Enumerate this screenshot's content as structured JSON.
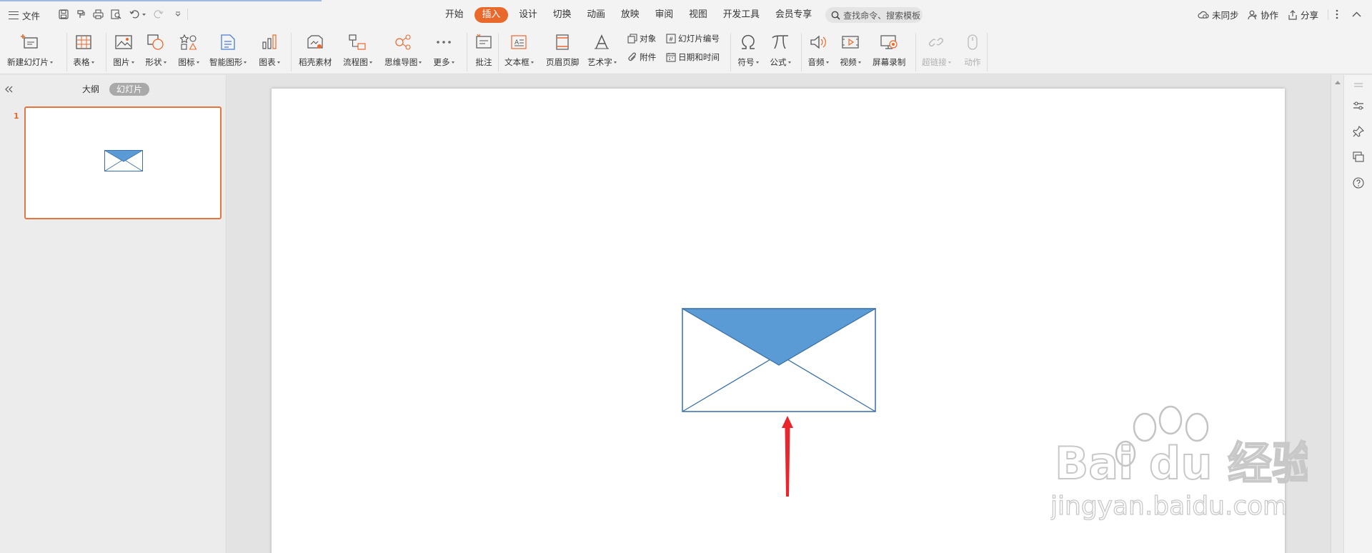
{
  "menubar": {
    "file_label": "文件",
    "tabs": [
      "开始",
      "插入",
      "设计",
      "切换",
      "动画",
      "放映",
      "审阅",
      "视图",
      "开发工具",
      "会员专享"
    ],
    "active_tab": "插入",
    "search_placeholder": "查找命令、搜索模板",
    "sync_label": "未同步",
    "collab_label": "协作",
    "share_label": "分享"
  },
  "ribbon": {
    "new_slide": "新建幻灯片",
    "table": "表格",
    "picture": "图片",
    "shape": "形状",
    "icon": "图标",
    "smart_art": "智能图形",
    "chart": "图表",
    "material": "稻壳素材",
    "flowchart": "流程图",
    "mindmap": "思维导图",
    "more": "更多",
    "comment": "批注",
    "textbox": "文本框",
    "header_footer": "页眉页脚",
    "wordart": "艺术字",
    "object": "对象",
    "attachment": "附件",
    "slide_number": "幻灯片编号",
    "date_time": "日期和时间",
    "symbol": "符号",
    "formula": "公式",
    "audio": "音频",
    "video": "视频",
    "screen_record": "屏幕录制",
    "hyperlink": "超链接",
    "action": "动作"
  },
  "leftpanel": {
    "outline_tab": "大纲",
    "slides_tab": "幻灯片",
    "slide_number": "1"
  },
  "colors": {
    "accent": "#e9692c",
    "envelope_fill": "#5b9bd5",
    "envelope_stroke": "#3a6ea5",
    "arrow": "#e8262c"
  },
  "watermark": {
    "brand": "Bai  du 经验",
    "url": "jingyan.baidu.com"
  }
}
